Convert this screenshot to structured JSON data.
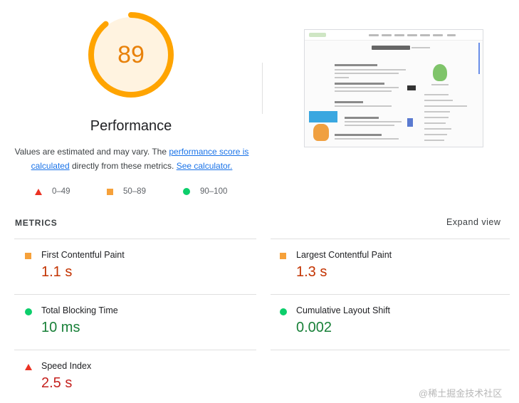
{
  "gauge": {
    "score": "89",
    "score_fraction": 0.89,
    "title": "Performance",
    "arc_color": "#ffa400",
    "fill_color": "#fff3e0"
  },
  "description": {
    "text_before": "Values are estimated and may vary. The ",
    "link_score": "performance score is calculated",
    "text_middle": " directly from these metrics. ",
    "link_calculator": "See calculator."
  },
  "legend": [
    {
      "shape": "triangle",
      "label": "0–49",
      "color": "#eb3223"
    },
    {
      "shape": "square",
      "label": "50–89",
      "color": "#f6a13a"
    },
    {
      "shape": "circle",
      "label": "90–100",
      "color": "#0cce6b"
    }
  ],
  "metrics_section": {
    "header": "METRICS",
    "expand_label": "Expand view",
    "items": [
      {
        "name": "First Contentful Paint",
        "value": "1.1 s",
        "status": "average"
      },
      {
        "name": "Largest Contentful Paint",
        "value": "1.3 s",
        "status": "average"
      },
      {
        "name": "Total Blocking Time",
        "value": "10 ms",
        "status": "pass"
      },
      {
        "name": "Cumulative Layout Shift",
        "value": "0.002",
        "status": "pass"
      },
      {
        "name": "Speed Index",
        "value": "2.5 s",
        "status": "fail"
      }
    ]
  },
  "watermark": "@稀土掘金技术社区"
}
